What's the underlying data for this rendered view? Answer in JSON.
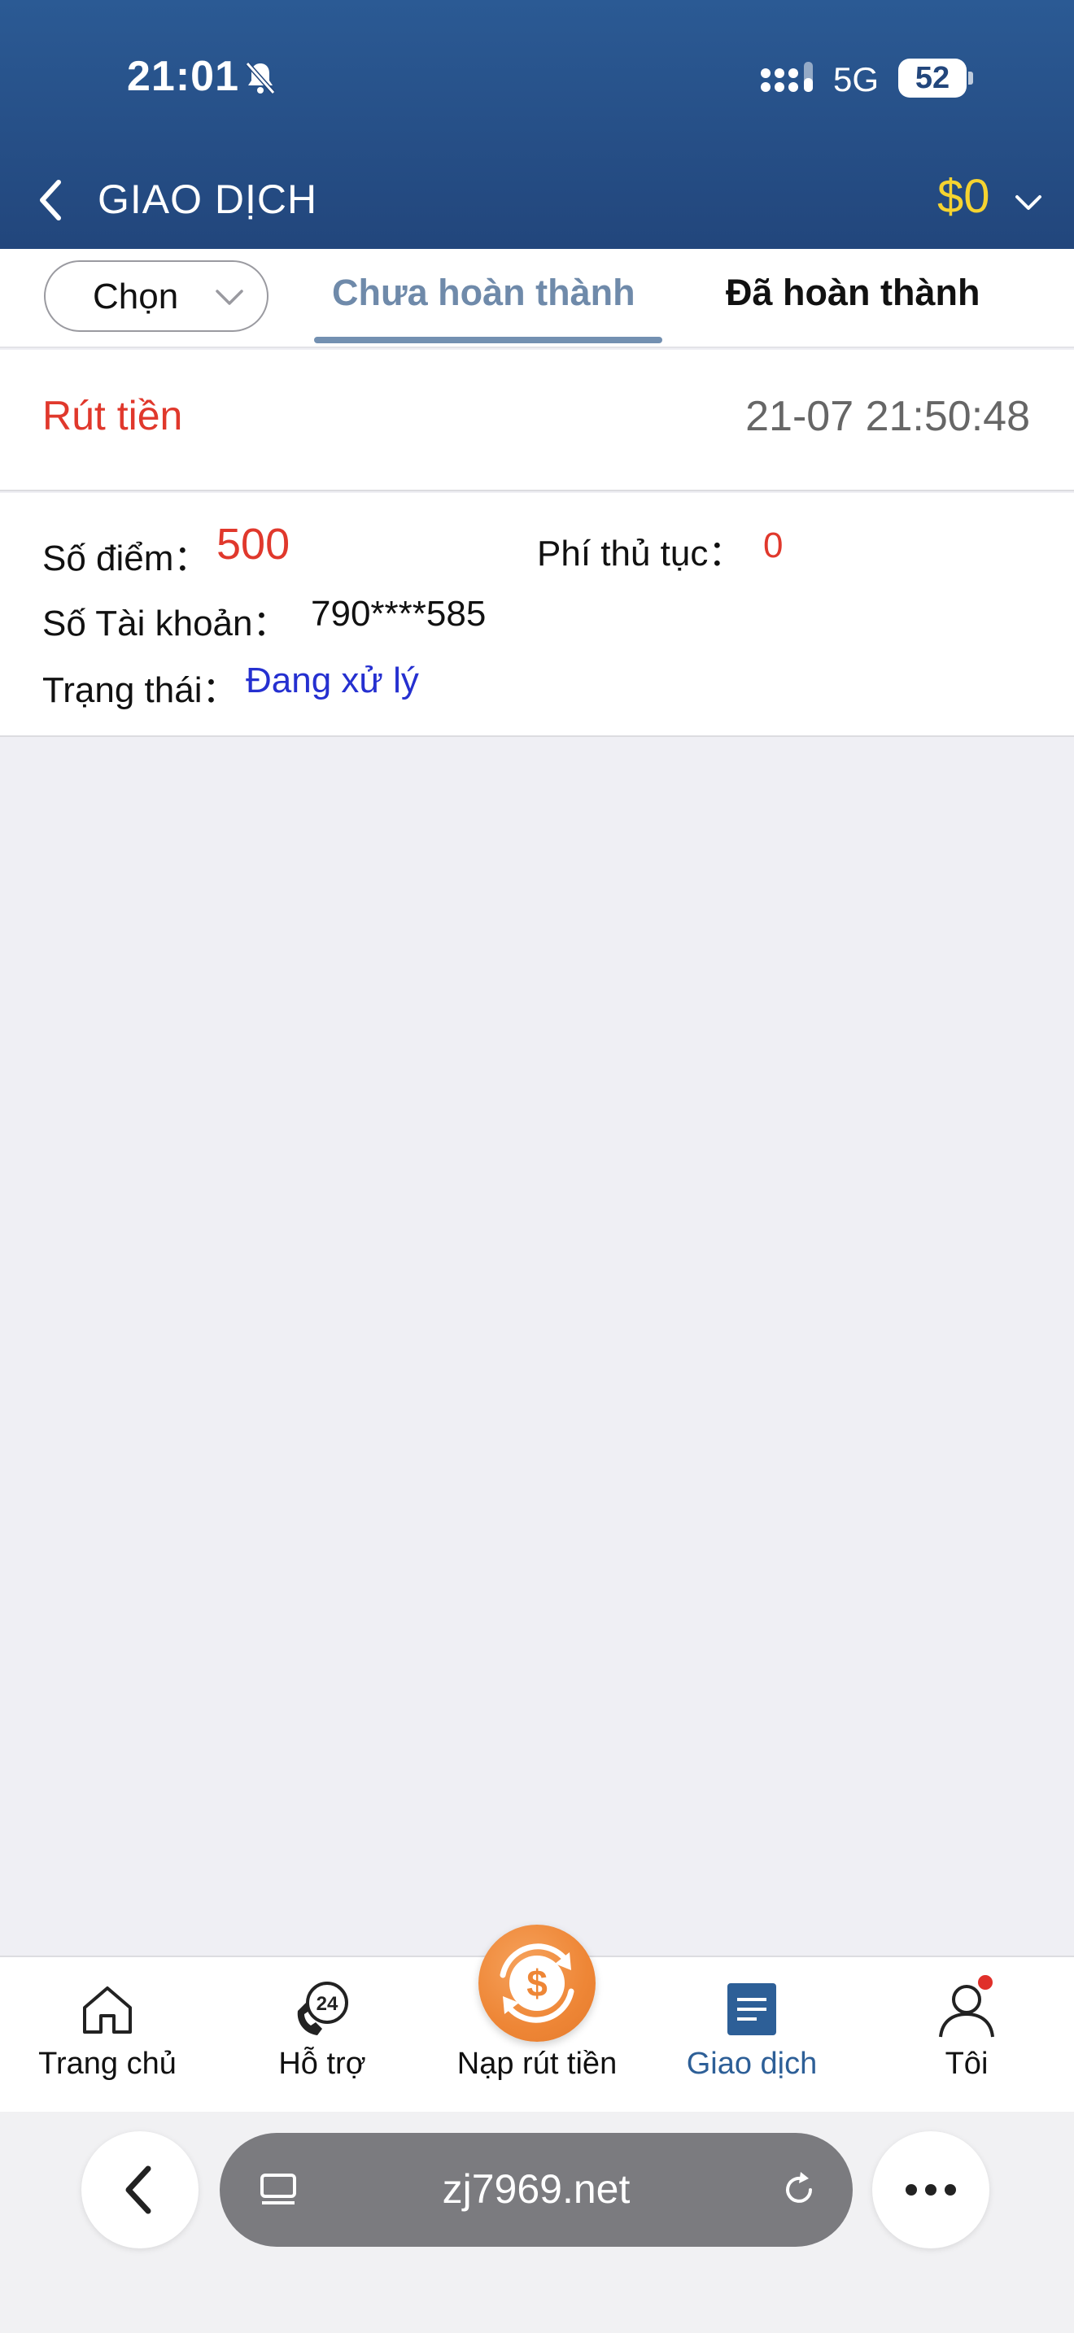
{
  "status_bar": {
    "time": "21:01",
    "network": "5G",
    "battery": "52"
  },
  "header": {
    "title": "GIAO DỊCH",
    "balance": "$0"
  },
  "tabs": {
    "select_label": "Chọn",
    "items": [
      {
        "label": "Chưa hoàn thành",
        "active": true
      },
      {
        "label": "Đã hoàn thành",
        "active": false
      }
    ]
  },
  "transaction": {
    "type": "Rút tiền",
    "datetime": "21-07 21:50:48",
    "points_label": "Số điểm：",
    "points_value": "500",
    "fee_label": "Phí thủ tục：",
    "fee_value": "0",
    "account_label": "Số Tài khoản：",
    "account_value": "790****585",
    "status_label": "Trạng thái：",
    "status_value": "Đang xử lý"
  },
  "bottom_nav": [
    {
      "label": "Trang chủ",
      "icon": "home-icon"
    },
    {
      "label": "Hỗ trợ",
      "icon": "support-24-icon"
    },
    {
      "label": "Nạp rút tiền",
      "icon": "deposit-withdraw-icon"
    },
    {
      "label": "Giao dịch",
      "icon": "transactions-icon",
      "active": true
    },
    {
      "label": "Tôi",
      "icon": "profile-icon"
    }
  ],
  "browser": {
    "url": "zj7969.net"
  },
  "colors": {
    "header_blue": "#22467c",
    "accent_red": "#e0382c",
    "balance_yellow": "#f5d330",
    "status_blue": "#2530d0",
    "center_orange": "#ee8636"
  }
}
